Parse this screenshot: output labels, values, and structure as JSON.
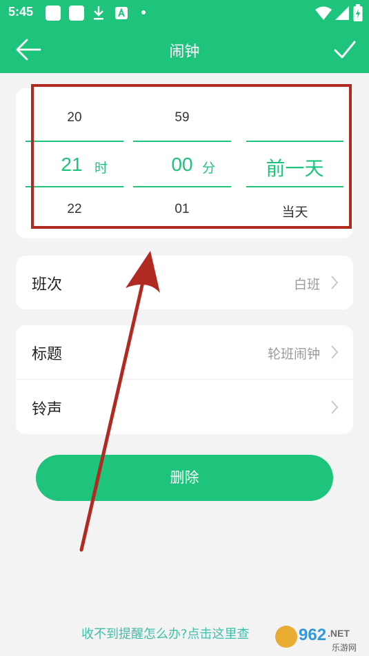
{
  "status_bar": {
    "time": "5:45"
  },
  "title_bar": {
    "title": "闹钟"
  },
  "picker": {
    "hour": {
      "prev": "20",
      "current": "21",
      "next": "22",
      "unit": "时"
    },
    "minute": {
      "prev": "59",
      "current": "00",
      "next": "01",
      "unit": "分"
    },
    "day": {
      "prev": "",
      "current": "前一天",
      "next": "当天"
    }
  },
  "shift_card": {
    "label": "班次",
    "value": "白班"
  },
  "details_card": {
    "title_row": {
      "label": "标题",
      "value": "轮班闹钟"
    },
    "ringtone_row": {
      "label": "铃声",
      "value": ""
    }
  },
  "delete_label": "删除",
  "help_link": "收不到提醒怎么办?点击这里查",
  "watermark": {
    "brand": "962",
    "suffix": ".NET",
    "sub": "乐游网"
  },
  "colors": {
    "primary": "#1ec47b",
    "highlight": "#b12a22",
    "link": "#3fbfa9"
  }
}
